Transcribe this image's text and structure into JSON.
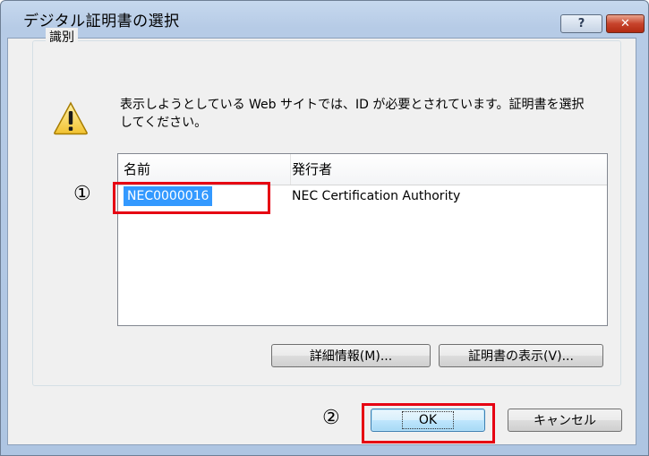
{
  "window": {
    "title": "デジタル証明書の選択",
    "help_icon": "help-icon",
    "close_icon": "close-icon"
  },
  "group": {
    "label": "識別",
    "message": "表示しようとしている Web サイトでは、ID が必要とされています。証明書を選択してください。",
    "warning_icon": "warning-icon"
  },
  "list": {
    "columns": [
      "名前",
      "発行者"
    ],
    "rows": [
      {
        "name": "NEC0000016",
        "issuer": "NEC Certification Authority",
        "selected": true
      }
    ],
    "selection_color": "#3399ff"
  },
  "buttons": {
    "details": "詳細情報(M)...",
    "view_cert": "証明書の表示(V)...",
    "ok": "OK",
    "cancel": "キャンセル"
  },
  "annotations": {
    "marker1": "①",
    "marker2": "②",
    "color": "#e60012"
  }
}
